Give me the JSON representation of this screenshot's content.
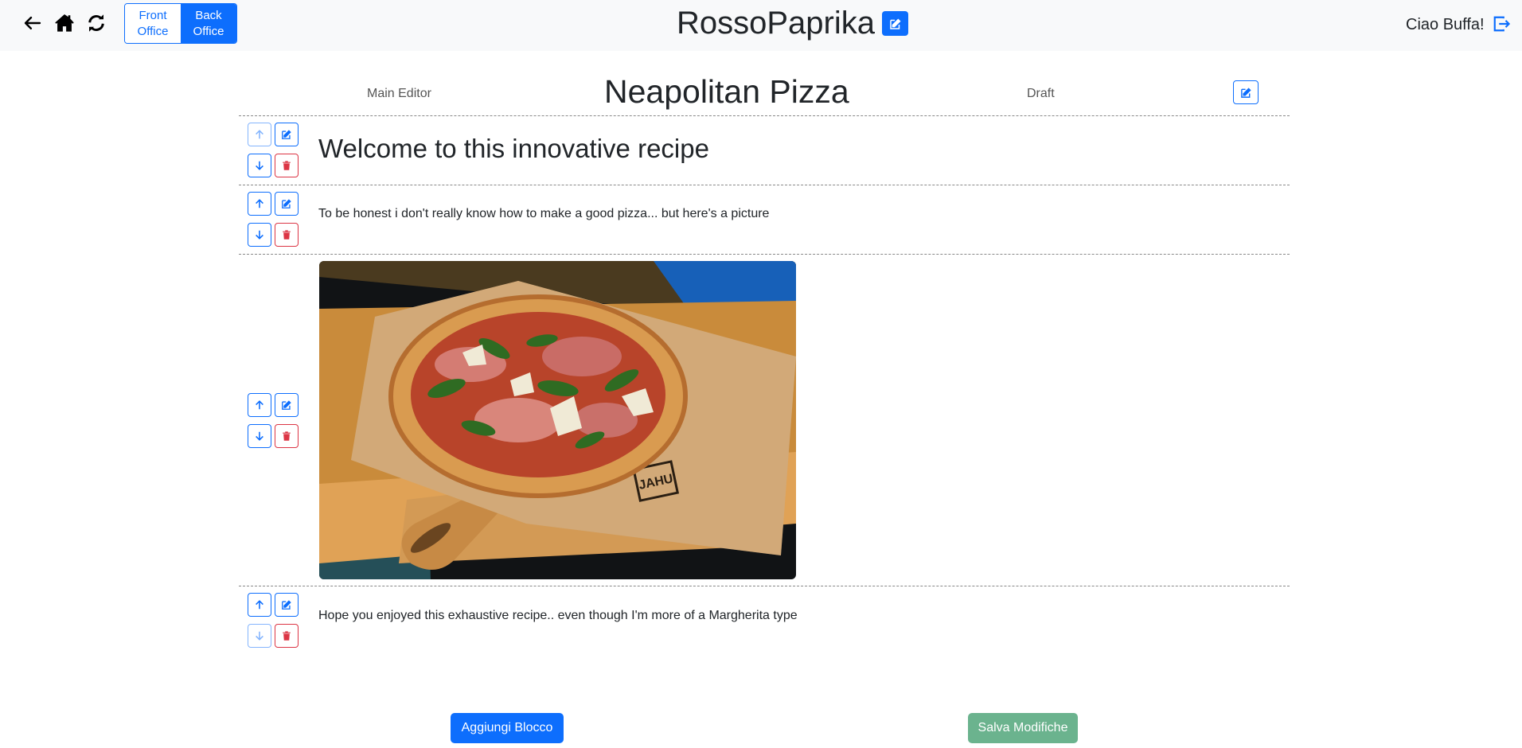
{
  "navbar": {
    "back_icon": "arrow-left-icon",
    "home_icon": "house-icon",
    "refresh_icon": "refresh-icon",
    "front_office_label": "Front Office",
    "back_office_label": "Back Office",
    "active_office": "Back Office",
    "brand": "RossoPaprika",
    "greeting": "Ciao Buffa!",
    "logout_icon": "box-arrow-right-icon"
  },
  "page": {
    "author": "Main Editor",
    "title": "Neapolitan Pizza",
    "status": "Draft"
  },
  "blocks": [
    {
      "type": "header",
      "content": "Welcome to this innovative recipe",
      "up_disabled": true,
      "down_disabled": false
    },
    {
      "type": "paragraph",
      "content": "To be honest i don't really know how to make a good pizza... but here's a picture",
      "up_disabled": false,
      "down_disabled": false
    },
    {
      "type": "image",
      "content": "pizza-photo",
      "up_disabled": false,
      "down_disabled": false
    },
    {
      "type": "paragraph",
      "content": "Hope you enjoyed this exhaustive recipe.. even though I'm more of a Margherita type",
      "up_disabled": false,
      "down_disabled": true
    }
  ],
  "actions": {
    "add_block_label": "Aggiungi Blocco",
    "save_label": "Salva Modifiche"
  },
  "colors": {
    "primary": "#0d6efd",
    "danger": "#dc3545",
    "success_muted": "#6bb38e",
    "navbar_bg": "#f8f9fa"
  }
}
